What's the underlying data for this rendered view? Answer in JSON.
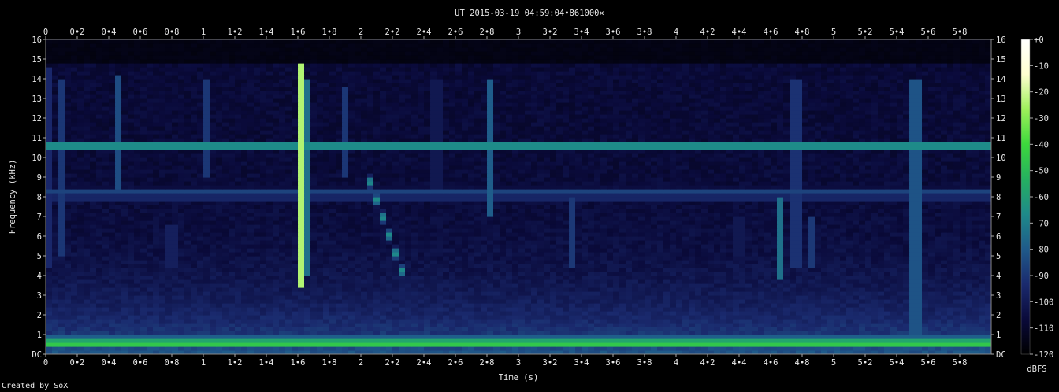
{
  "chart_data": {
    "type": "heatmap",
    "title": "UT 2015-03-19 04:59:04•861000×",
    "xlabel": "Time (s)",
    "ylabel": "Frequency (kHz)",
    "xlim": [
      0,
      6.0
    ],
    "ylim": [
      0,
      16
    ],
    "x_ticks": [
      "0",
      "0•2",
      "0•4",
      "0•6",
      "0•8",
      "1",
      "1•2",
      "1•4",
      "1•6",
      "1•8",
      "2",
      "2•2",
      "2•4",
      "2•6",
      "2•8",
      "3",
      "3•2",
      "3•4",
      "3•6",
      "3•8",
      "4",
      "4•2",
      "4•4",
      "4•6",
      "4•8",
      "5",
      "5•2",
      "5•4",
      "5•6",
      "5•8"
    ],
    "y_ticks": [
      "DC",
      "1",
      "2",
      "3",
      "4",
      "5",
      "6",
      "7",
      "8",
      "9",
      "10",
      "11",
      "12",
      "13",
      "14",
      "15",
      "16"
    ],
    "colorbar": {
      "label": "dBFS",
      "range": [
        -120,
        0
      ],
      "ticks": [
        "+0",
        "-10",
        "-20",
        "-30",
        "-40",
        "-50",
        "-60",
        "-70",
        "-80",
        "-90",
        "-100",
        "-110",
        "-120"
      ],
      "colors": [
        "#000000",
        "#0a0a3a",
        "#1a2a6e",
        "#1f5a8a",
        "#1e8a8a",
        "#25b060",
        "#3cd83c",
        "#9ef05a",
        "#ffffd0",
        "#ffffff"
      ]
    },
    "features": {
      "tones_khz": [
        {
          "freq": 0.5,
          "level": 0.62
        },
        {
          "freq": 0.75,
          "level": 0.55
        },
        {
          "freq": 10.6,
          "level": 0.55
        },
        {
          "freq": 8.3,
          "level": 0.28
        },
        {
          "freq": 8.0,
          "level": 0.25
        }
      ],
      "impulses_s": [
        {
          "t": 0.03,
          "fmin": 4.5,
          "fmax": 14.5,
          "level": 0.25
        },
        {
          "t": 0.1,
          "fmin": 5.0,
          "fmax": 14.0,
          "level": 0.25
        },
        {
          "t": 0.46,
          "fmin": 8.5,
          "fmax": 14.2,
          "level": 0.3
        },
        {
          "t": 0.8,
          "fmin": 4.5,
          "fmax": 6.5,
          "level": 0.35
        },
        {
          "t": 1.02,
          "fmin": 9.0,
          "fmax": 14.0,
          "level": 0.25
        },
        {
          "t": 1.62,
          "fmin": 3.4,
          "fmax": 14.8,
          "level": 0.8
        },
        {
          "t": 1.65,
          "fmin": 4.0,
          "fmax": 14.0,
          "level": 0.45
        },
        {
          "t": 1.9,
          "fmin": 9.0,
          "fmax": 13.5,
          "level": 0.25
        },
        {
          "t": 2.48,
          "fmin": 8.5,
          "fmax": 14.0,
          "level": 0.3
        },
        {
          "t": 2.83,
          "fmin": 7.0,
          "fmax": 14.0,
          "level": 0.4
        },
        {
          "t": 3.33,
          "fmin": 4.5,
          "fmax": 8.0,
          "level": 0.3
        },
        {
          "t": 4.4,
          "fmin": 5.0,
          "fmax": 7.0,
          "level": 0.3
        },
        {
          "t": 4.65,
          "fmin": 3.8,
          "fmax": 8.0,
          "level": 0.45
        },
        {
          "t": 4.76,
          "fmin": 4.5,
          "fmax": 14.0,
          "level": 0.45
        },
        {
          "t": 4.85,
          "fmin": 4.5,
          "fmax": 7.0,
          "level": 0.3
        },
        {
          "t": 5.52,
          "fmin": 0.3,
          "fmax": 14.0,
          "level": 0.6
        }
      ],
      "sweep": {
        "t_start": 2.05,
        "f_start": 9.0,
        "t_end": 2.28,
        "f_end": 3.8,
        "level": 0.45
      },
      "noise_floor": 0.08
    }
  },
  "footer": {
    "credit": "Created by SoX"
  }
}
